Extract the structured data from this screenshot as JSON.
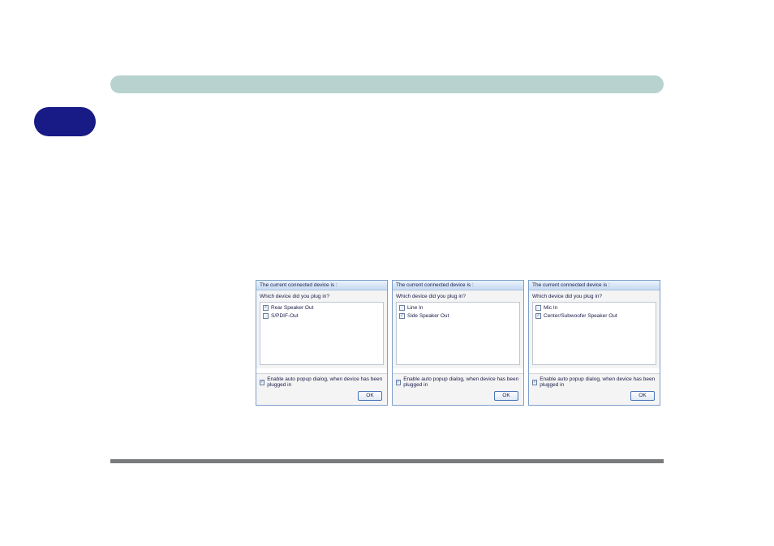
{
  "dialogs": [
    {
      "title": "The current connected device is :",
      "question": "Which device did you plug in?",
      "options": [
        {
          "checked": true,
          "label": "Rear Speaker Out"
        },
        {
          "checked": false,
          "label": "S/PDIF-Out"
        }
      ],
      "autopopup_label": "Enable auto popup dialog, when device has been plugged in",
      "ok_label": "OK"
    },
    {
      "title": "The current connected device is :",
      "question": "Which device did you plug in?",
      "options": [
        {
          "checked": false,
          "label": "Line In"
        },
        {
          "checked": true,
          "label": "Side Speaker Out"
        }
      ],
      "autopopup_label": "Enable auto popup dialog, when device has been plugged in",
      "ok_label": "OK"
    },
    {
      "title": "The current connected device is :",
      "question": "Which device did you plug in?",
      "options": [
        {
          "checked": false,
          "label": "Mic In"
        },
        {
          "checked": true,
          "label": "Center/Subwoofer Speaker Out"
        }
      ],
      "autopopup_label": "Enable auto popup dialog, when device has been plugged in",
      "ok_label": "OK"
    }
  ]
}
